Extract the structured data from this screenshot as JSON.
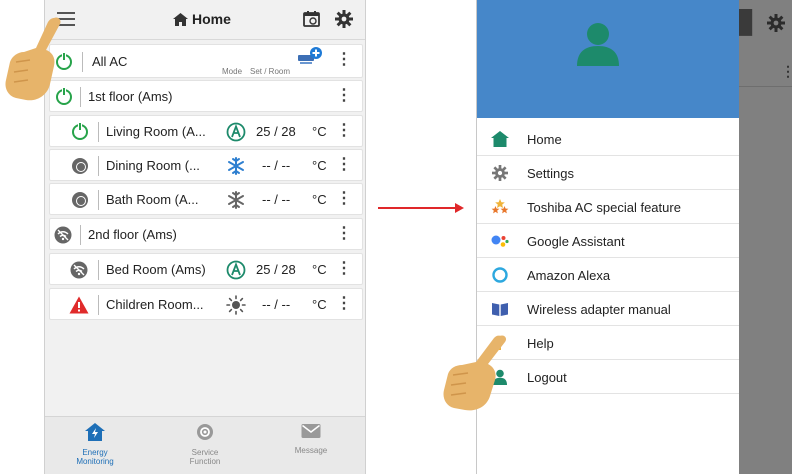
{
  "left": {
    "topbar": {
      "title": "Home"
    },
    "rows": [
      {
        "label": "All AC",
        "sub_mode": "Mode",
        "sub_set": "Set / Room"
      },
      {
        "label": "1st floor (Ams)"
      },
      {
        "label": "Living Room (A...",
        "temp": "25 / 28",
        "unit": "°C"
      },
      {
        "label": "Dining Room (...",
        "temp": "-- / --",
        "unit": "°C"
      },
      {
        "label": "Bath Room (A...",
        "temp": "-- / --",
        "unit": "°C"
      },
      {
        "label": "2nd floor (Ams)"
      },
      {
        "label": "Bed Room (Ams)",
        "temp": "25 / 28",
        "unit": "°C"
      },
      {
        "label": "Children Room...",
        "temp": "-- / --",
        "unit": "°C"
      }
    ],
    "tabs": [
      {
        "line1": "Energy",
        "line2": "Monitoring"
      },
      {
        "line1": "Service",
        "line2": "Function"
      },
      {
        "line1": "Message",
        "line2": ""
      }
    ]
  },
  "drawer": {
    "items": [
      {
        "label": "Home",
        "icon": "home-icon"
      },
      {
        "label": "Settings",
        "icon": "gear-icon"
      },
      {
        "label": "Toshiba AC special feature",
        "icon": "star-stack-icon"
      },
      {
        "label": "Google Assistant",
        "icon": "google-assistant-icon"
      },
      {
        "label": "Amazon Alexa",
        "icon": "alexa-icon"
      },
      {
        "label": "Wireless adapter manual",
        "icon": "book-icon"
      },
      {
        "label": "Help",
        "icon": "help-icon"
      },
      {
        "label": "Logout",
        "icon": "logout-icon"
      }
    ]
  },
  "colors": {
    "accent_green": "#1d8a6b",
    "header_blue": "#4687c9",
    "power_green": "#27a34a",
    "arrow_red": "#e0282a",
    "hand": "#e7b46a"
  }
}
